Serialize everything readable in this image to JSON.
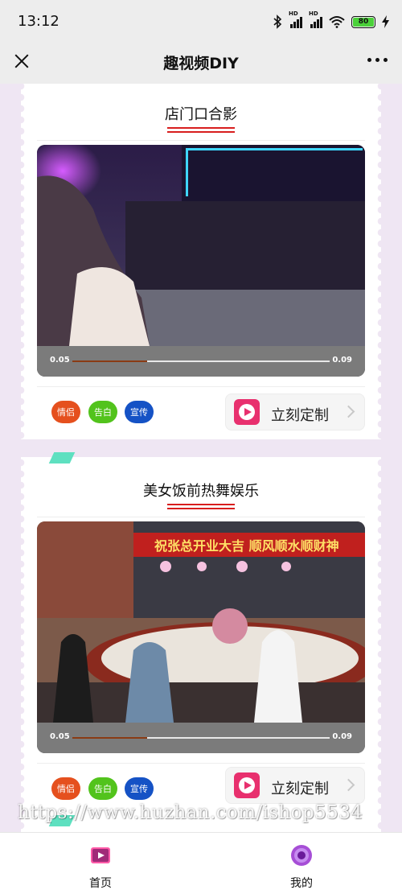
{
  "status_bar": {
    "time": "13:12",
    "network_label": "HD",
    "battery_level": "80",
    "icons": [
      "bluetooth-icon",
      "signal-icon",
      "signal-icon",
      "wifi-icon",
      "battery-icon",
      "charging-icon"
    ]
  },
  "nav": {
    "title": "趣视频DIY",
    "close_icon": "close-icon",
    "more_icon": "more-icon"
  },
  "cards": [
    {
      "title": "店门口合影",
      "time_start": "0.05",
      "time_end": "0.09",
      "progress": 0.29,
      "tags": [
        "情侣",
        "告白",
        "宣传"
      ],
      "cta_label": "立刻定制"
    },
    {
      "title": "美女饭前热舞娱乐",
      "banner_text": "祝张总开业大吉 顺风顺水顺财神",
      "time_start": "0.05",
      "time_end": "0.09",
      "progress": 0.29,
      "tags": [
        "情侣",
        "告白",
        "宣传"
      ],
      "cta_label": "立刻定制"
    }
  ],
  "tag_colors": [
    "#e5501e",
    "#52c31c",
    "#1552c5"
  ],
  "accent_color": "#d81e1e",
  "watermark": "https://www.huzhan.com/ishop5534",
  "tabbar": {
    "home_label": "首页",
    "me_label": "我的"
  }
}
